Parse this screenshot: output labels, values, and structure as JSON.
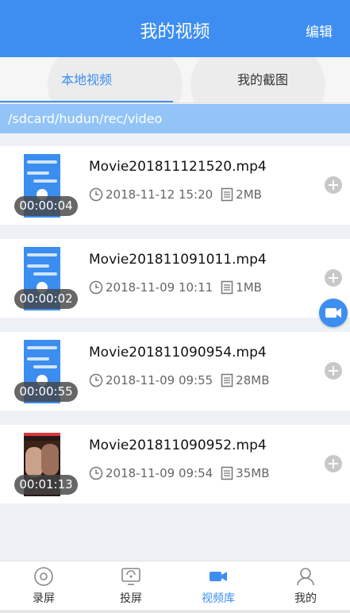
{
  "header": {
    "title": "我的视频",
    "edit_label": "编辑"
  },
  "tabs": [
    {
      "label": "本地视频",
      "active": true
    },
    {
      "label": "我的截图",
      "active": false
    }
  ],
  "path": "/sdcard/hudun/rec/video",
  "videos": [
    {
      "name": "Movie201811121520.mp4",
      "date": "2018-11-12 15:20",
      "size": "2MB",
      "duration": "00:00:04",
      "thumb": "screen"
    },
    {
      "name": "Movie201811091011.mp4",
      "date": "2018-11-09 10:11",
      "size": "1MB",
      "duration": "00:00:02",
      "thumb": "screen"
    },
    {
      "name": "Movie201811090954.mp4",
      "date": "2018-11-09 09:55",
      "size": "28MB",
      "duration": "00:00:55",
      "thumb": "screen"
    },
    {
      "name": "Movie201811090952.mp4",
      "date": "2018-11-09 09:54",
      "size": "35MB",
      "duration": "00:01:13",
      "thumb": "photo"
    }
  ],
  "fab_icon": "video-camera-icon",
  "bottom_nav": [
    {
      "label": "录屏",
      "icon": "record-icon",
      "active": false
    },
    {
      "label": "投屏",
      "icon": "cast-icon",
      "active": false
    },
    {
      "label": "视频库",
      "icon": "video-library-icon",
      "active": true
    },
    {
      "label": "我的",
      "icon": "profile-icon",
      "active": false
    }
  ],
  "colors": {
    "primary": "#3d8ef0",
    "path_bar": "#93c4f7"
  }
}
